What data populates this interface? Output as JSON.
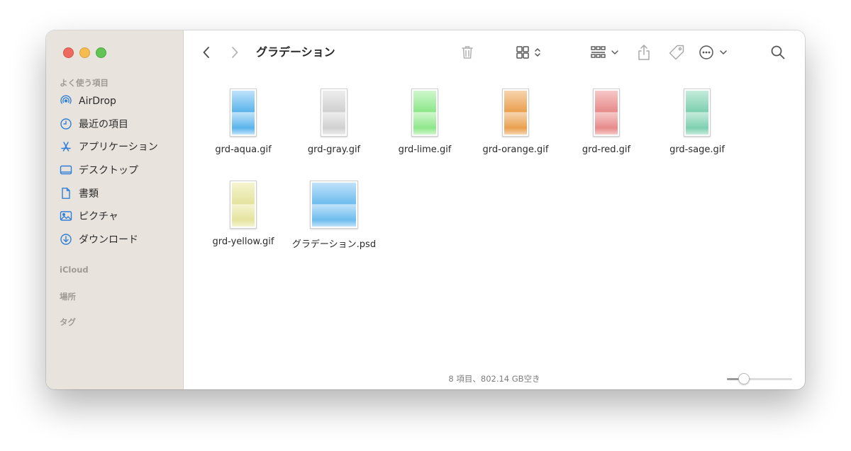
{
  "window": {
    "title": "グラデーション"
  },
  "sidebar": {
    "favorites_heading": "よく使う項目",
    "items": [
      {
        "label": "AirDrop",
        "icon": "airdrop-icon"
      },
      {
        "label": "最近の項目",
        "icon": "clock-icon"
      },
      {
        "label": "アプリケーション",
        "icon": "applications-icon"
      },
      {
        "label": "デスクトップ",
        "icon": "desktop-icon"
      },
      {
        "label": "書類",
        "icon": "document-icon"
      },
      {
        "label": "ピクチャ",
        "icon": "photo-icon"
      },
      {
        "label": "ダウンロード",
        "icon": "download-icon"
      }
    ],
    "icloud_heading": "iCloud",
    "locations_heading": "場所",
    "tags_heading": "タグ"
  },
  "toolbar": {
    "back_icon": "chevron-left-icon",
    "forward_icon": "chevron-right-icon",
    "trash_icon": "trash-icon",
    "view_icon": "grid-view-icon",
    "group_icon": "group-icon",
    "share_icon": "share-icon",
    "tag_icon": "tag-icon",
    "more_icon": "ellipsis-circle-icon",
    "search_icon": "search-icon"
  },
  "files": [
    {
      "name": "grd-aqua.gif",
      "color": "#5ab4ec",
      "light": "#bfe3fa"
    },
    {
      "name": "grd-gray.gif",
      "color": "#d0d0d0",
      "light": "#ededed"
    },
    {
      "name": "grd-lime.gif",
      "color": "#8de78a",
      "light": "#cff7cc"
    },
    {
      "name": "grd-orange.gif",
      "color": "#eba04f",
      "light": "#f6d4ae"
    },
    {
      "name": "grd-red.gif",
      "color": "#e88a8a",
      "light": "#f6c8c8"
    },
    {
      "name": "grd-sage.gif",
      "color": "#7dd0b0",
      "light": "#c4ebdb"
    },
    {
      "name": "grd-yellow.gif",
      "color": "#e4e39e",
      "light": "#f5f4cf"
    },
    {
      "name": "グラデーション.psd",
      "color": "#6ebcee",
      "light": "#bfe2fa"
    }
  ],
  "status": {
    "text": "8 項目、802.14 GB空き",
    "zoom_level": 0.26
  }
}
